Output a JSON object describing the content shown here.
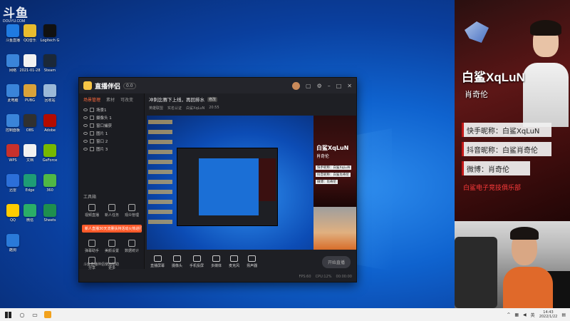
{
  "desktop": {
    "watermark": "斗鱼",
    "watermark_sub": "DOUYU.COM",
    "icons": [
      {
        "label": "斗鱼直播",
        "color": "#1f7ae0"
      },
      {
        "label": "QQ音乐",
        "color": "#e8bb2e"
      },
      {
        "label": "Logitech G",
        "color": "#111111"
      },
      {
        "label": "网络",
        "color": "#3a84d9"
      },
      {
        "label": "2021-01-28",
        "color": "#f1f1f1"
      },
      {
        "label": "Steam",
        "color": "#1b2838"
      },
      {
        "label": "此电脑",
        "color": "#3a84d9"
      },
      {
        "label": "PUBG",
        "color": "#d9a23a"
      },
      {
        "label": "回收站",
        "color": "#9ab8d8"
      },
      {
        "label": "控制面板",
        "color": "#3a84d9"
      },
      {
        "label": "OBS",
        "color": "#303030"
      },
      {
        "label": "Adobe",
        "color": "#b30b00"
      },
      {
        "label": "WPS",
        "color": "#c8312b"
      },
      {
        "label": "文档",
        "color": "#f1f1f1"
      },
      {
        "label": "GeForce",
        "color": "#76b900"
      },
      {
        "label": "迅雷",
        "color": "#2c6fd8"
      },
      {
        "label": "Edge",
        "color": "#1e9c75"
      },
      {
        "label": "360",
        "color": "#4fb845"
      },
      {
        "label": "QQ",
        "color": "#ffcc00"
      },
      {
        "label": "微信",
        "color": "#2aae67"
      },
      {
        "label": "Sheets",
        "color": "#1e8f4e"
      },
      {
        "label": "酷狗",
        "color": "#2a7ad9"
      }
    ]
  },
  "app": {
    "name": "直播伴侣",
    "version": "0.0",
    "left_tabs": [
      "场景管理",
      "素材",
      "可改变"
    ],
    "scenes": [
      "场景1",
      "摄像头 1",
      "窗口捕获",
      "图片 1",
      "窗口 2",
      "图片 3"
    ],
    "tools_header": "工具箱",
    "promo": "新人直播30天流量扶持活动火热进行中",
    "tools": [
      "视频直播",
      "新人任务",
      "观众管理",
      "弹幕助手",
      "美颜设置",
      "数据统计",
      "分享",
      "更多"
    ],
    "bottom_left": "斗鱼直播伴侣使用帮助",
    "live_title": "冲刺比赛下上线，再回排水",
    "live_tag": "修改",
    "sub_info": [
      "英雄联盟",
      "实名认证",
      "白鲨XqLuN",
      "20:55"
    ],
    "bottom_tools": [
      "直播屏幕",
      "摄像头",
      "手机投屏",
      "多媒体",
      "麦克风",
      "扬声器"
    ],
    "go_live": "开始直播",
    "status_text": [
      "FPS:60",
      "CPU:12%",
      "00:00:00"
    ]
  },
  "card": {
    "title": "白鲨XqLuN",
    "name": "肖奇伦",
    "kuaishou": "快手昵称：白鲨XqLuN",
    "douyin": "抖音昵称：白鲨肖奇伦",
    "weibo": "微博：肖奇伦",
    "club": "白鲨电子竞技俱乐部"
  },
  "taskbar": {
    "time": "14:43",
    "date": "2022/1/22",
    "lang": "英"
  }
}
